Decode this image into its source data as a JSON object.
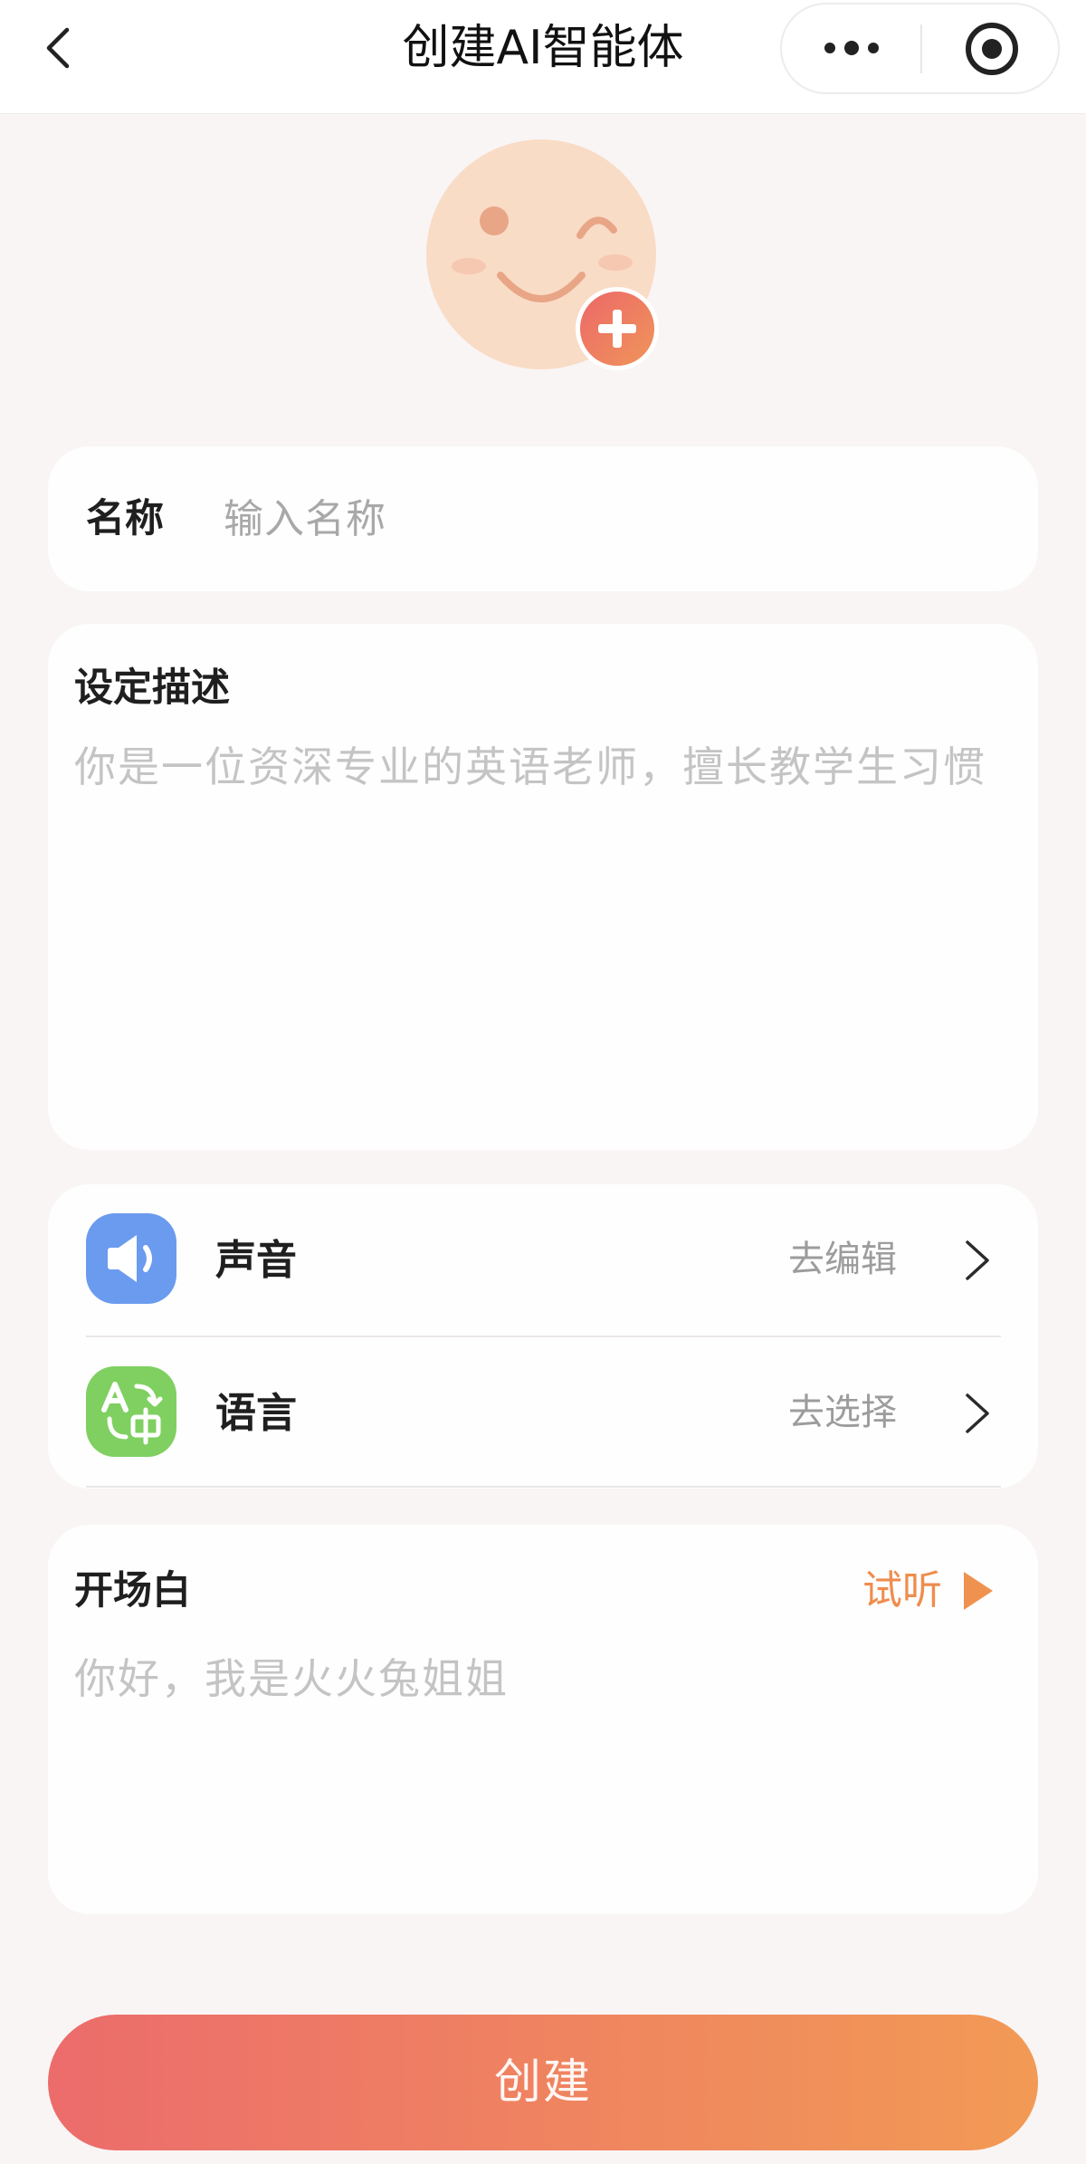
{
  "nav": {
    "title": "创建AI智能体",
    "back_icon": "chevron-left-icon",
    "more_icon": "more-dots-icon",
    "close_icon": "target-circle-icon"
  },
  "avatar": {
    "icon": "smiley-face-icon",
    "add_icon": "plus-icon",
    "face_color": "#f9dcc6"
  },
  "name_field": {
    "label": "名称",
    "placeholder": "输入名称"
  },
  "description": {
    "title": "设定描述",
    "placeholder": "你是一位资深专业的英语老师，擅长教学生习惯"
  },
  "settings": [
    {
      "label": "声音",
      "action": "去编辑",
      "icon": "speaker-icon",
      "icon_color": "#6b9bef",
      "chevron_icon": "chevron-right-icon"
    },
    {
      "label": "语言",
      "action": "去选择",
      "icon": "translate-icon",
      "icon_color": "#7fd060",
      "chevron_icon": "chevron-right-icon"
    }
  ],
  "opening": {
    "title": "开场白",
    "preview_label": "试听",
    "preview_icon": "play-icon",
    "placeholder": "你好，我是火火兔姐姐"
  },
  "create_button": {
    "label": "创建"
  },
  "colors": {
    "page_background": "#f9f5f5",
    "card_background": "#fffefe",
    "accent_orange": "#ee8d4e",
    "button_gradient_start": "#ec6c6c",
    "button_gradient_end": "#f29a55"
  }
}
